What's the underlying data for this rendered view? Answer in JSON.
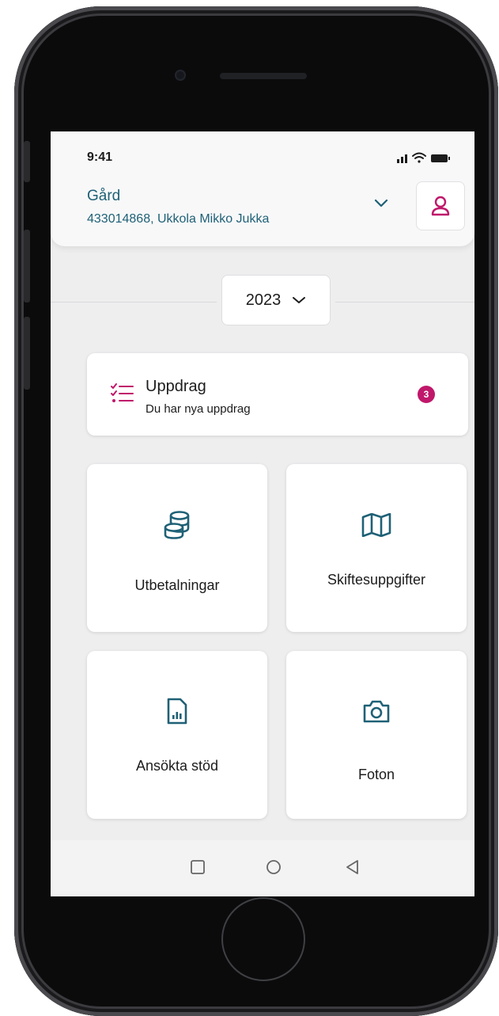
{
  "status_bar": {
    "time": "9:41"
  },
  "header": {
    "farm_label": "Gård",
    "farm_value": "433014868, Ukkola Mikko Jukka"
  },
  "year_selector": {
    "value": "2023"
  },
  "tasks_card": {
    "title": "Uppdrag",
    "subtitle": "Du har nya uppdrag",
    "badge_count": "3"
  },
  "tiles": [
    {
      "label": "Utbetalningar",
      "icon": "coins-stack-icon"
    },
    {
      "label": "Skiftesuppgifter",
      "icon": "map-icon"
    },
    {
      "label": "Ansökta stöd",
      "icon": "report-document-icon"
    },
    {
      "label": "Foton",
      "icon": "camera-icon"
    }
  ],
  "colors": {
    "accent_teal": "#1f6176",
    "accent_magenta": "#c0176b",
    "screen_background": "#eeeeef"
  }
}
